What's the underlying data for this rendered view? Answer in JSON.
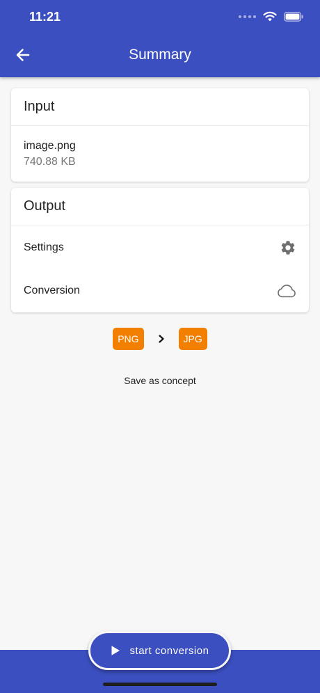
{
  "status_bar": {
    "time": "11:21"
  },
  "appbar": {
    "title": "Summary",
    "back_icon": "arrow-left-icon"
  },
  "input_card": {
    "title": "Input",
    "file_name": "image.png",
    "file_size": "740.88 KB"
  },
  "output_card": {
    "title": "Output",
    "settings_label": "Settings",
    "settings_icon": "gear-icon",
    "conversion_label": "Conversion",
    "conversion_icon": "cloud-icon"
  },
  "formats": {
    "from": "PNG",
    "to": "JPG"
  },
  "save_concept_label": "Save as concept",
  "start_button_label": "start conversion",
  "colors": {
    "primary": "#3c4fc0",
    "accent_chip": "#f37f00",
    "background": "#f7f7f7"
  }
}
